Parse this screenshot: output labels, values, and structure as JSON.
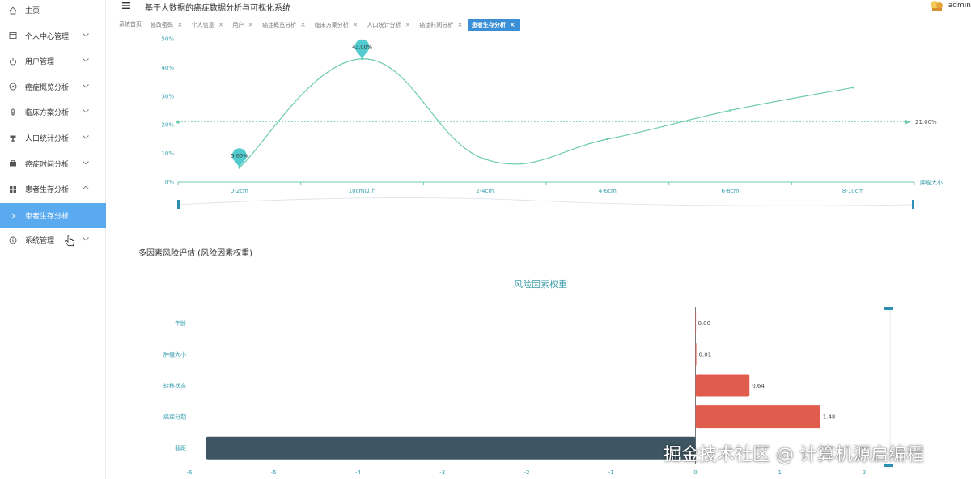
{
  "header": {
    "title": "基于大数据的癌症数据分析与可视化系统",
    "user": "admin"
  },
  "sidebar": {
    "items": [
      {
        "label": "主页",
        "icon": "home-icon",
        "has_chevron": false,
        "chevron": "",
        "active": false
      },
      {
        "label": "个人中心管理",
        "icon": "window-icon",
        "has_chevron": true,
        "chevron": "down",
        "active": false
      },
      {
        "label": "用户管理",
        "icon": "power-icon",
        "has_chevron": true,
        "chevron": "down",
        "active": false
      },
      {
        "label": "癌症概览分析",
        "icon": "compass-icon",
        "has_chevron": true,
        "chevron": "down",
        "active": false
      },
      {
        "label": "临床方案分析",
        "icon": "microphone-icon",
        "has_chevron": true,
        "chevron": "down",
        "active": false
      },
      {
        "label": "人口统计分析",
        "icon": "trophy-icon",
        "has_chevron": true,
        "chevron": "down",
        "active": false
      },
      {
        "label": "癌症时间分析",
        "icon": "briefcase-icon",
        "has_chevron": true,
        "chevron": "down",
        "active": false
      },
      {
        "label": "患者生存分析",
        "icon": "grid-icon",
        "has_chevron": true,
        "chevron": "up",
        "active": false
      },
      {
        "label": "患者生存分析",
        "icon": "chevron-right-icon",
        "has_chevron": false,
        "chevron": "",
        "active": true
      },
      {
        "label": "系统管理",
        "icon": "info-icon",
        "has_chevron": true,
        "chevron": "down",
        "active": false
      }
    ]
  },
  "tabs": [
    {
      "label": "系统首页",
      "closable": false,
      "active": false
    },
    {
      "label": "修改密码",
      "closable": true,
      "active": false
    },
    {
      "label": "个人信息",
      "closable": true,
      "active": false
    },
    {
      "label": "用户",
      "closable": true,
      "active": false
    },
    {
      "label": "癌症概览分析",
      "closable": true,
      "active": false
    },
    {
      "label": "临床方案分析",
      "closable": true,
      "active": false
    },
    {
      "label": "人口统计分析",
      "closable": true,
      "active": false
    },
    {
      "label": "癌症时间分析",
      "closable": true,
      "active": false
    },
    {
      "label": "患者生存分析",
      "closable": true,
      "active": true
    }
  ],
  "tab_close_glyph": "×",
  "section_title": "多因素风险评估 (风险因素权重)",
  "colors": {
    "sidebar_active": "#5aaaf0",
    "tab_active": "#3a8fd6",
    "line": "#6ccab0",
    "marker": "#3ec5c8",
    "bar_positive": "#e05c4c",
    "bar_negative": "#3e5663",
    "axis_label": "#3aa1b0"
  },
  "watermark": "掘金技术社区 @ 计算机源启编程",
  "chart_data": [
    {
      "type": "line",
      "categories": [
        "0-2cm",
        "10cm以上",
        "2-4cm",
        "4-6cm",
        "6-8cm",
        "8-10cm"
      ],
      "values": [
        5,
        43,
        8,
        15,
        25,
        33
      ],
      "xlabel": "肿瘤大小",
      "ylim": [
        0,
        50
      ],
      "yticks": [
        "0%",
        "10%",
        "20%",
        "30%",
        "40%",
        "50%"
      ],
      "smooth": true,
      "mark_points": [
        {
          "index": 0,
          "label": "5.00%"
        },
        {
          "index": 1,
          "label": "43.00%"
        }
      ],
      "mark_line": {
        "value": 21,
        "label": "21.00%"
      },
      "data_zoom": true
    },
    {
      "type": "bar",
      "orientation": "horizontal",
      "title": "风险因素权重",
      "categories": [
        "年龄",
        "肿瘤大小",
        "转移状态",
        "癌症分期",
        "截距"
      ],
      "values": [
        0.0,
        0.01,
        0.64,
        1.48,
        -5.8
      ],
      "value_labels": [
        "0.00",
        "0.01",
        "0.64",
        "1.48",
        ""
      ],
      "xlim": [
        -6,
        2
      ],
      "xticks": [
        "-6",
        "-5",
        "-4",
        "-3",
        "-2",
        "-1",
        "0",
        "1",
        "2"
      ],
      "data_zoom": true
    }
  ]
}
